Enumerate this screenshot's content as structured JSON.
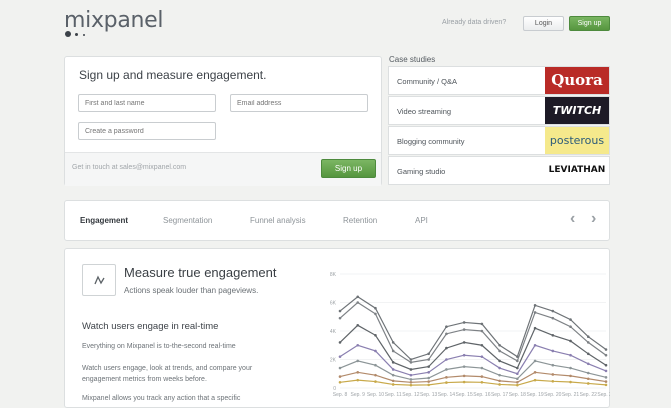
{
  "header": {
    "logo_text": "mixpanel",
    "tagline": "Already data driven?",
    "login_label": "Login",
    "signup_label": "Sign up"
  },
  "signup": {
    "title": "Sign up and measure engagement.",
    "name_placeholder": "First and last name",
    "email_placeholder": "Email address",
    "password_placeholder": "Create a password",
    "contact_text": "Get in touch at sales@mixpanel.com",
    "button_label": "Sign up"
  },
  "case_studies": {
    "title": "Case studies",
    "items": [
      {
        "label": "Community / Q&A",
        "brand": "Quora",
        "brand_bg": "#b92b27",
        "brand_color": "#ffffff"
      },
      {
        "label": "Video streaming",
        "brand": "TWITCH",
        "brand_bg": "#1d1a26",
        "brand_color": "#ffffff"
      },
      {
        "label": "Blogging community",
        "brand": "posterous",
        "brand_bg": "#f5e98c",
        "brand_color": "#2a5a7a"
      },
      {
        "label": "Gaming studio",
        "brand": "LEVIATHAN",
        "brand_bg": "#ffffff",
        "brand_color": "#111111"
      }
    ]
  },
  "tabs": [
    {
      "label": "Engagement",
      "active": true
    },
    {
      "label": "Segmentation",
      "active": false
    },
    {
      "label": "Funnel analysis",
      "active": false
    },
    {
      "label": "Retention",
      "active": false
    },
    {
      "label": "API",
      "active": false
    }
  ],
  "nav": {
    "prev_icon": "chevron-left-icon",
    "next_icon": "chevron-right-icon"
  },
  "feature": {
    "icon": "trend-line-icon",
    "title": "Measure true engagement",
    "subtitle": "Actions speak louder than pageviews.",
    "section_heading": "Watch users engage in real-time",
    "paragraph1": "Everything on Mixpanel is to-the-second real-time",
    "paragraph2": "Watch users engage, look at trends, and compare your engagement metrics from weeks before.",
    "paragraph3": "Mixpanel allows you track any action that a specific"
  },
  "colors": {
    "accent_green": "#5e9e45",
    "panel_bg": "#ffffff",
    "page_bg": "#f1f2f0"
  },
  "chart_data": {
    "type": "line",
    "x": [
      "Sep. 8",
      "Sep. 9",
      "Sep. 10",
      "Sep. 11",
      "Sep. 12",
      "Sep. 13",
      "Sep. 14",
      "Sep. 15",
      "Sep. 16",
      "Sep. 17",
      "Sep. 18",
      "Sep. 19",
      "Sep. 20",
      "Sep. 21",
      "Sep. 22",
      "Sep. 23"
    ],
    "y_ticks": [
      "0",
      "2K",
      "4K",
      "6K",
      "8K"
    ],
    "ylim": [
      0,
      8000
    ],
    "grid": true,
    "series": [
      {
        "color": "#6e7377",
        "values": [
          5400,
          6400,
          5600,
          3200,
          2000,
          2400,
          4300,
          4600,
          4500,
          3000,
          2200,
          5800,
          5400,
          4800,
          3600,
          2700
        ]
      },
      {
        "color": "#7d8185",
        "values": [
          4900,
          6000,
          5200,
          2600,
          1800,
          2000,
          3800,
          4100,
          4000,
          2600,
          1900,
          5300,
          4900,
          4300,
          3200,
          2300
        ]
      },
      {
        "color": "#5f6468",
        "values": [
          3200,
          4400,
          3700,
          1800,
          1300,
          1500,
          2800,
          3200,
          3000,
          1900,
          1400,
          4200,
          3700,
          3300,
          2400,
          1600
        ]
      },
      {
        "color": "#8a7fb0",
        "values": [
          2200,
          3000,
          2600,
          1300,
          900,
          1100,
          2000,
          2300,
          2200,
          1400,
          1000,
          3000,
          2600,
          2300,
          1700,
          1200
        ]
      },
      {
        "color": "#b28a6a",
        "values": [
          800,
          1100,
          900,
          500,
          400,
          450,
          750,
          850,
          800,
          500,
          400,
          1100,
          950,
          850,
          650,
          450
        ]
      },
      {
        "color": "#c8a94a",
        "values": [
          400,
          550,
          450,
          250,
          200,
          220,
          380,
          420,
          400,
          250,
          200,
          550,
          470,
          420,
          320,
          220
        ]
      },
      {
        "color": "#8c9597",
        "values": [
          1400,
          1900,
          1600,
          900,
          600,
          700,
          1300,
          1500,
          1400,
          900,
          650,
          1900,
          1600,
          1400,
          1050,
          750
        ]
      }
    ]
  }
}
